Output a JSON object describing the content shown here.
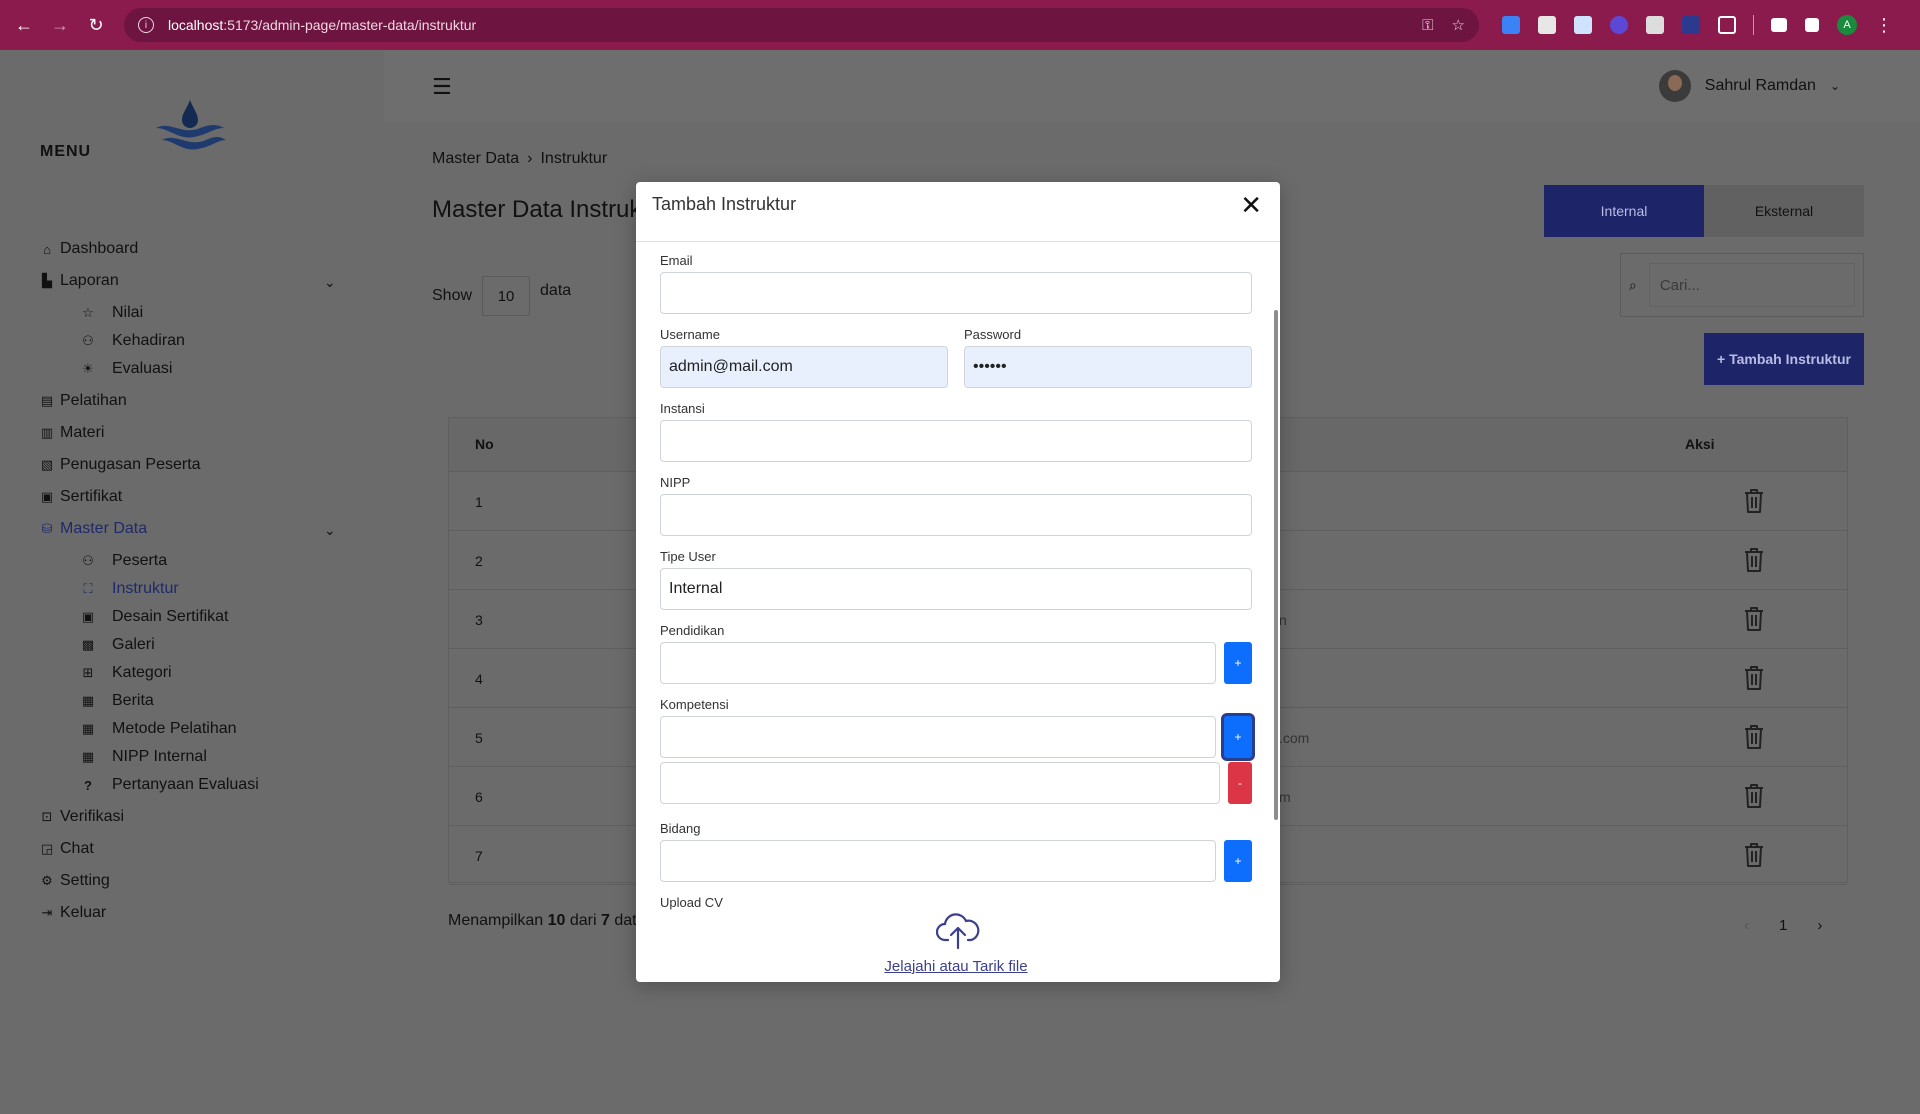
{
  "browser": {
    "url_host": "localhost",
    "url_rest": ":5173/admin-page/master-data/instruktur"
  },
  "sidebar": {
    "menu_title": "MENU",
    "items": [
      {
        "label": "Dashboard",
        "icon": "home-icon"
      },
      {
        "label": "Laporan",
        "icon": "chart-icon"
      },
      {
        "label": "Pelatihan",
        "icon": "document-icon"
      },
      {
        "label": "Materi",
        "icon": "book-icon"
      },
      {
        "label": "Penugasan Peserta",
        "icon": "clipboard-icon"
      },
      {
        "label": "Sertifikat",
        "icon": "certificate-icon"
      },
      {
        "label": "Master Data",
        "icon": "database-icon"
      },
      {
        "label": "Verifikasi",
        "icon": "verify-icon"
      },
      {
        "label": "Chat",
        "icon": "chat-icon"
      },
      {
        "label": "Setting",
        "icon": "gear-icon"
      },
      {
        "label": "Keluar",
        "icon": "logout-icon"
      }
    ],
    "laporan_sub": [
      {
        "label": "Nilai",
        "icon": "star-icon"
      },
      {
        "label": "Kehadiran",
        "icon": "users-icon"
      },
      {
        "label": "Evaluasi",
        "icon": "sun-icon"
      }
    ],
    "master_sub": [
      {
        "label": "Peserta",
        "icon": "users-icon"
      },
      {
        "label": "Instruktur",
        "icon": "teacher-icon"
      },
      {
        "label": "Desain Sertifikat",
        "icon": "certificate-icon"
      },
      {
        "label": "Galeri",
        "icon": "gallery-icon"
      },
      {
        "label": "Kategori",
        "icon": "grid-icon"
      },
      {
        "label": "Berita",
        "icon": "news-icon"
      },
      {
        "label": "Metode Pelatihan",
        "icon": "news-icon"
      },
      {
        "label": "NIPP Internal",
        "icon": "news-icon"
      },
      {
        "label": "Pertanyaan Evaluasi",
        "icon": "question-icon"
      }
    ]
  },
  "header": {
    "user_name": "Sahrul Ramdan"
  },
  "main": {
    "breadcrumb": [
      "Master Data",
      "Instruktur"
    ],
    "title": "Master Data Instruk",
    "tabs": [
      "Internal",
      "Eksternal"
    ],
    "show_label": "Show",
    "show_value": "10",
    "data_label": "data",
    "search_placeholder": "Cari...",
    "add_button": "+ Tambah Instruktur",
    "table": {
      "col_no": "No",
      "col_aksi": "Aksi",
      "rows": [
        {
          "no": "1",
          "frag": ""
        },
        {
          "no": "2",
          "frag": ""
        },
        {
          "no": "3",
          "frag": "n"
        },
        {
          "no": "4",
          "frag": ""
        },
        {
          "no": "5",
          "frag": ".com"
        },
        {
          "no": "6",
          "frag": "m"
        },
        {
          "no": "7",
          "frag": ""
        }
      ]
    },
    "footer_prefix": "Menampilkan ",
    "footer_count": "10",
    "footer_mid": " dari ",
    "footer_total": "7",
    "footer_suffix": " dat",
    "pager": {
      "prev": "‹",
      "page": "1",
      "next": "›"
    }
  },
  "modal": {
    "title": "Tambah Instruktur",
    "email_label": "Email",
    "email_value": "",
    "username_label": "Username",
    "username_value": "admin@mail.com",
    "password_label": "Password",
    "password_value": "••••••",
    "instansi_label": "Instansi",
    "nipp_label": "NIPP",
    "tipe_label": "Tipe User",
    "tipe_value": "Internal",
    "pendidikan_label": "Pendidikan",
    "kompetensi_label": "Kompetensi",
    "bidang_label": "Bidang",
    "upload_label": "Upload CV",
    "upload_link": "Jelajahi atau Tarik file",
    "plus": "+",
    "minus": "-"
  }
}
